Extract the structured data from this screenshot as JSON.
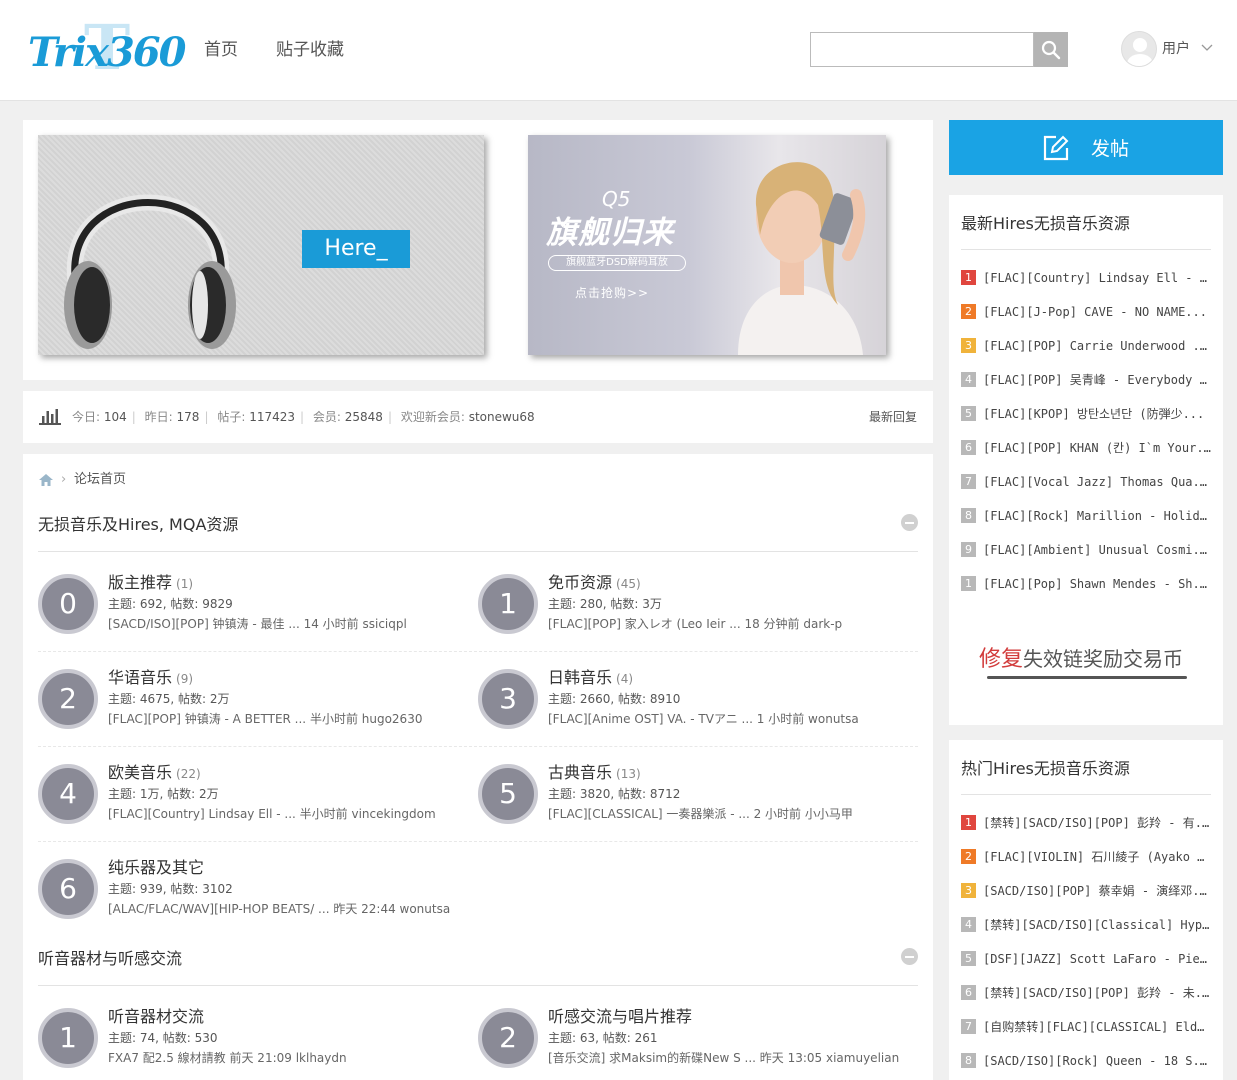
{
  "header": {
    "logo_text": "Trix360",
    "nav": [
      "首页",
      "贴子收藏"
    ],
    "search_placeholder": "",
    "user_label": "用户"
  },
  "banners": {
    "left_button": "Here_",
    "right_q5": "Q5",
    "right_title": "旗舰归来",
    "right_subtitle": "旗舰蓝牙DSD解码耳放",
    "right_cta": "点击抢购>>"
  },
  "stats": {
    "today_label": "今日:",
    "today": "104",
    "yesterday_label": "昨日:",
    "yesterday": "178",
    "posts_label": "帖子:",
    "posts": "117423",
    "members_label": "会员:",
    "members": "25848",
    "welcome_label": "欢迎新会员:",
    "new_member": "stonewu68",
    "latest_reply": "最新回复"
  },
  "breadcrumb": {
    "current": "论坛首页"
  },
  "sections": [
    {
      "title": "无损音乐及Hires, MQA资源",
      "forums": [
        {
          "num": "0",
          "name": "版主推荐",
          "count": "(1)",
          "meta": "主题: 692, 帖数: 9829",
          "last": "[SACD/ISO][POP] 钟镇涛 - 最佳 ... 14 小时前 ssiciqpl"
        },
        {
          "num": "1",
          "name": "免币资源",
          "count": "(45)",
          "meta": "主题: 280, 帖数: 3万",
          "last": "[FLAC][POP] 家入レオ (Leo Ieir ... 18 分钟前 dark-p"
        },
        {
          "num": "2",
          "name": "华语音乐",
          "count": "(9)",
          "meta": "主题: 4675, 帖数: 2万",
          "last": "[FLAC][POP] 钟镇涛 - A BETTER ... 半小时前 hugo2630"
        },
        {
          "num": "3",
          "name": "日韩音乐",
          "count": "(4)",
          "meta": "主题: 2660, 帖数: 8910",
          "last": "[FLAC][Anime OST] VA. - TVアニ ... 1 小时前 wonutsa"
        },
        {
          "num": "4",
          "name": "欧美音乐",
          "count": "(22)",
          "meta": "主题: 1万, 帖数: 2万",
          "last": "[FLAC][Country] Lindsay Ell - ... 半小时前 vincekingdom"
        },
        {
          "num": "5",
          "name": "古典音乐",
          "count": "(13)",
          "meta": "主题: 3820, 帖数: 8712",
          "last": "[FLAC][CLASSICAL] 一奏器樂派 - ... 2 小时前 小小马甲"
        },
        {
          "num": "6",
          "name": "纯乐器及其它",
          "count": "",
          "meta": "主题: 939, 帖数: 3102",
          "last": "[ALAC/FLAC/WAV][HIP-HOP BEATS/ ... 昨天 22:44 wonutsa"
        }
      ]
    },
    {
      "title": "听音器材与听感交流",
      "forums": [
        {
          "num": "1",
          "name": "听音器材交流",
          "count": "",
          "meta": "主题: 74, 帖数: 530",
          "last": "FXA7 配2.5 線材請教 前天 21:09 lklhaydn"
        },
        {
          "num": "2",
          "name": "听感交流与唱片推荐",
          "count": "",
          "meta": "主题: 63, 帖数: 261",
          "last": "[音乐交流] 求Maksim的新碟New S ... 昨天 13:05 xiamuyelian"
        }
      ]
    }
  ],
  "sidebar": {
    "post_button": "发帖",
    "latest": {
      "title": "最新Hires无损音乐资源",
      "items": [
        {
          "rank": "1",
          "text": "[FLAC][Country] Lindsay Ell - Th..."
        },
        {
          "rank": "2",
          "text": "[FLAC][J-Pop] CAVE - NO NAME..."
        },
        {
          "rank": "3",
          "text": "[FLAC][POP] Carrie Underwood ..."
        },
        {
          "rank": "4",
          "text": "[FLAC][POP] 吴青峰 - Everybody ..."
        },
        {
          "rank": "5",
          "text": "[FLAC][KPOP] 방탄소년단 (防弾少..."
        },
        {
          "rank": "6",
          "text": "[FLAC][POP] KHAN (칸) I`m Your..."
        },
        {
          "rank": "7",
          "text": "[FLAC][Vocal Jazz] Thomas Qua..."
        },
        {
          "rank": "8",
          "text": "[FLAC][Rock] Marillion - Holida..."
        },
        {
          "rank": "9",
          "text": "[FLAC][Ambient] Unusual Cosmi..."
        },
        {
          "rank": "1",
          "text": "[FLAC][Pop] Shawn Mendes - Sh..."
        }
      ],
      "repair_red": "修复",
      "repair_gray": "失效链奖励交易币"
    },
    "hot": {
      "title": "热门Hires无损音乐资源",
      "items": [
        {
          "rank": "1",
          "text": "[禁转][SACD/ISO][POP] 彭羚 - 有..."
        },
        {
          "rank": "2",
          "text": "[FLAC][VIOLIN] 石川綾子 (Ayako ..."
        },
        {
          "rank": "3",
          "text": "[SACD/ISO][POP] 蔡幸娟 - 演绎邓..."
        },
        {
          "rank": "4",
          "text": "[禁转][SACD/ISO][Classical] Hyp..."
        },
        {
          "rank": "5",
          "text": "[DSF][JAZZ] Scott LaFaro - Piec..."
        },
        {
          "rank": "6",
          "text": "[禁转][SACD/ISO][POP] 彭羚 - 未..."
        },
        {
          "rank": "7",
          "text": "[自购禁转][FLAC][CLASSICAL] Eld..."
        },
        {
          "rank": "8",
          "text": "[SACD/ISO][Rock] Queen - 18 S..."
        }
      ]
    }
  },
  "colors": {
    "accent": "#1aa3e4",
    "rank1": "#e0463e",
    "rank2": "#ef7a27",
    "rank3": "#f0b33b",
    "rank_other": "#b8b8b8"
  },
  "icons": [
    "search-icon",
    "user-avatar-icon",
    "chevron-down-icon",
    "stats-bar-icon",
    "home-icon",
    "edit-icon",
    "collapse-icon"
  ]
}
